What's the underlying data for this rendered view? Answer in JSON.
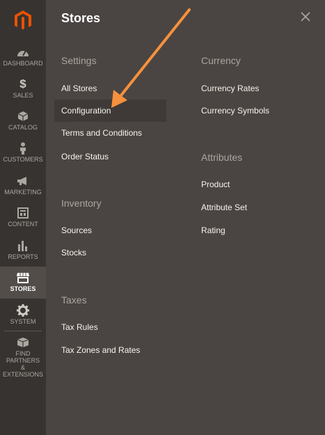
{
  "sidebar": {
    "items": [
      {
        "label": "DASHBOARD",
        "icon": "dashboard-icon"
      },
      {
        "label": "SALES",
        "icon": "dollar-icon"
      },
      {
        "label": "CATALOG",
        "icon": "cube-icon"
      },
      {
        "label": "CUSTOMERS",
        "icon": "person-icon"
      },
      {
        "label": "MARKETING",
        "icon": "megaphone-icon"
      },
      {
        "label": "CONTENT",
        "icon": "layout-icon"
      },
      {
        "label": "REPORTS",
        "icon": "bar-chart-icon"
      },
      {
        "label": "STORES",
        "icon": "store-icon",
        "active": true
      },
      {
        "label": "SYSTEM",
        "icon": "gear-icon"
      },
      {
        "label_line1": "FIND PARTNERS",
        "label_line2": "& EXTENSIONS",
        "icon": "box-icon"
      }
    ]
  },
  "panel": {
    "title": "Stores",
    "settings": {
      "heading": "Settings",
      "links": [
        "All Stores",
        "Configuration",
        "Terms and Conditions",
        "Order Status"
      ]
    },
    "inventory": {
      "heading": "Inventory",
      "links": [
        "Sources",
        "Stocks"
      ]
    },
    "taxes": {
      "heading": "Taxes",
      "links": [
        "Tax Rules",
        "Tax Zones and Rates"
      ]
    },
    "currency": {
      "heading": "Currency",
      "links": [
        "Currency Rates",
        "Currency Symbols"
      ]
    },
    "attributes": {
      "heading": "Attributes",
      "links": [
        "Product",
        "Attribute Set",
        "Rating"
      ]
    }
  },
  "colors": {
    "brand_orange": "#eb5202",
    "annotation_arrow": "#f7913d"
  }
}
